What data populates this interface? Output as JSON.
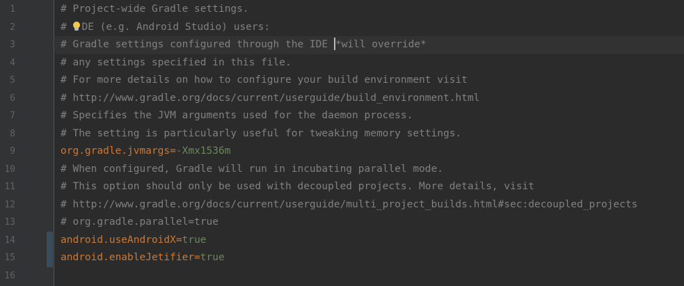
{
  "editor": {
    "lines": [
      {
        "num": "1",
        "parts": [
          {
            "cls": "comment",
            "text": "# Project-wide Gradle settings."
          }
        ]
      },
      {
        "num": "2",
        "parts": [
          {
            "cls": "comment",
            "text": "# "
          },
          {
            "icon": "lightbulb-icon"
          },
          {
            "cls": "comment",
            "text": "DE (e.g. Android Studio) users:"
          }
        ]
      },
      {
        "num": "3",
        "current": true,
        "parts": [
          {
            "cls": "comment",
            "text": "# Gradle settings configured through the IDE "
          },
          {
            "caret": true
          },
          {
            "cls": "comment",
            "text": "*will override*"
          }
        ]
      },
      {
        "num": "4",
        "parts": [
          {
            "cls": "comment",
            "text": "# any settings specified in this file."
          }
        ]
      },
      {
        "num": "5",
        "parts": [
          {
            "cls": "comment",
            "text": "# For more details on how to configure your build environment visit"
          }
        ]
      },
      {
        "num": "6",
        "parts": [
          {
            "cls": "comment",
            "text": "# http://www.gradle.org/docs/current/userguide/build_environment.html"
          }
        ]
      },
      {
        "num": "7",
        "parts": [
          {
            "cls": "comment",
            "text": "# Specifies the JVM arguments used for the daemon process."
          }
        ]
      },
      {
        "num": "8",
        "parts": [
          {
            "cls": "comment",
            "text": "# The setting is particularly useful for tweaking memory settings."
          }
        ]
      },
      {
        "num": "9",
        "parts": [
          {
            "cls": "key",
            "text": "org.gradle.jvmargs"
          },
          {
            "cls": "eq",
            "text": "="
          },
          {
            "cls": "val",
            "text": "-Xmx1536m"
          }
        ]
      },
      {
        "num": "10",
        "parts": [
          {
            "cls": "comment",
            "text": "# When configured, Gradle will run in incubating parallel mode."
          }
        ]
      },
      {
        "num": "11",
        "parts": [
          {
            "cls": "comment",
            "text": "# This option should only be used with decoupled projects. More details, visit"
          }
        ]
      },
      {
        "num": "12",
        "parts": [
          {
            "cls": "comment",
            "text": "# http://www.gradle.org/docs/current/userguide/multi_project_builds.html#sec:decoupled_projects"
          }
        ]
      },
      {
        "num": "13",
        "parts": [
          {
            "cls": "comment",
            "text": "# org.gradle.parallel=true"
          }
        ]
      },
      {
        "num": "14",
        "changed": true,
        "parts": [
          {
            "cls": "key",
            "text": "android.useAndroidX"
          },
          {
            "cls": "eq",
            "text": "="
          },
          {
            "cls": "val",
            "text": "true"
          }
        ]
      },
      {
        "num": "15",
        "changed": true,
        "parts": [
          {
            "cls": "key",
            "text": "android.enableJetifier"
          },
          {
            "cls": "eq",
            "text": "="
          },
          {
            "cls": "val",
            "text": "true"
          }
        ]
      },
      {
        "num": "16",
        "parts": []
      }
    ]
  }
}
